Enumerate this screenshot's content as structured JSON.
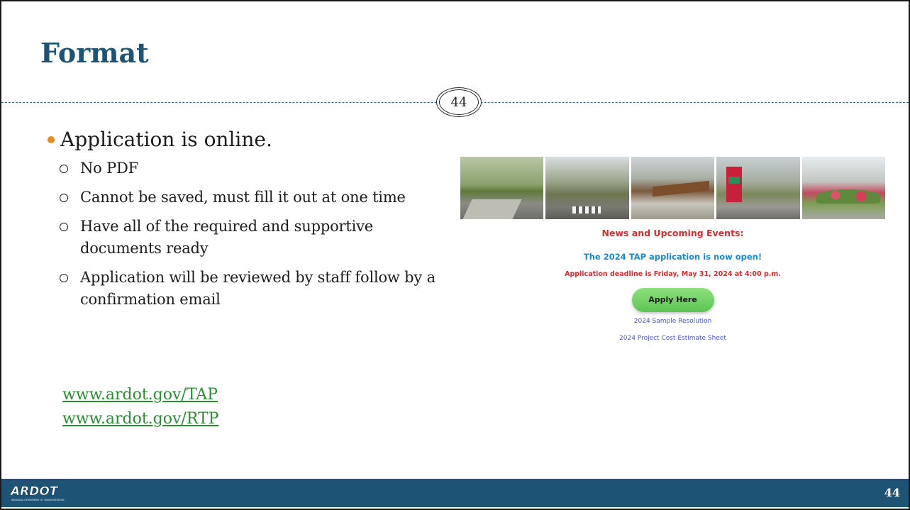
{
  "slide": {
    "title": "Format",
    "page_badge": "44",
    "footer_page": "44"
  },
  "bullets": {
    "main": "Application is online.",
    "sub": [
      "No PDF",
      "Cannot be saved, must fill it out at one time",
      "Have all of the required and supportive documents ready",
      "Application will be reviewed by staff follow by a confirmation email"
    ]
  },
  "links": [
    "www.ardot.gov/TAP",
    "www.ardot.gov/RTP"
  ],
  "web_panel": {
    "news_title": "News and Upcoming Events:",
    "tap_open": "The 2024 TAP application is now open!",
    "deadline": "Application deadline is Friday, May 31, 2024 at 4:00 p.m.",
    "apply_button": "Apply Here",
    "doc_links": [
      "2024 Sample Resolution",
      "2024 Project Cost Estimate Sheet"
    ]
  },
  "logo": {
    "text": "ARDOT",
    "subtext": "ARKANSAS DEPARTMENT OF TRANSPORTATION"
  },
  "colors": {
    "title": "#1d5476",
    "footer": "#1d5476",
    "bullet_dot": "#f08a1d",
    "link": "#2b8d33",
    "news_red": "#d12e2e",
    "news_blue": "#1f86c9",
    "apply_green": "#5cc552"
  }
}
